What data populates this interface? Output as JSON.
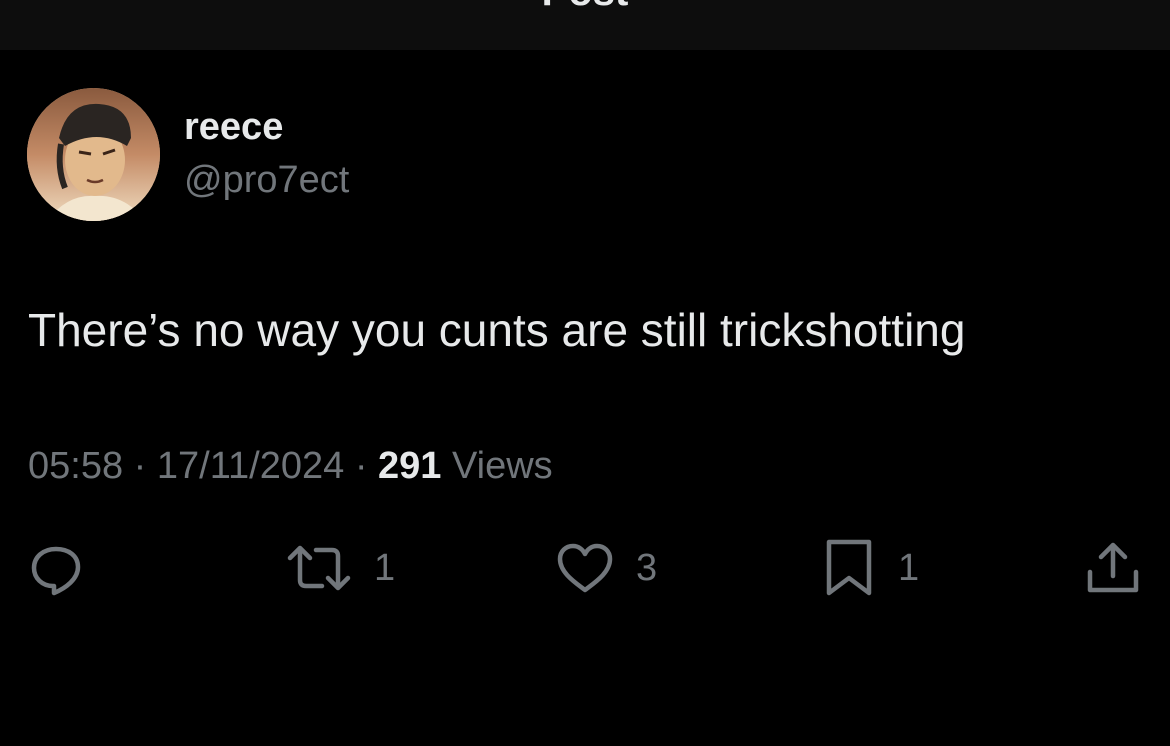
{
  "header": {
    "title": "Post"
  },
  "author": {
    "display_name": "reece",
    "handle": "@pro7ect"
  },
  "post": {
    "text": "There’s no way you cunts are still trickshotting",
    "time": "05:58",
    "date": "17/11/2024",
    "separator": "·",
    "views_count": "291",
    "views_label": "Views"
  },
  "actions": {
    "reply": {
      "icon": "reply-icon"
    },
    "repost": {
      "icon": "repost-icon",
      "count": "1"
    },
    "like": {
      "icon": "heart-icon",
      "count": "3"
    },
    "bookmark": {
      "icon": "bookmark-icon",
      "count": "1"
    },
    "share": {
      "icon": "share-icon"
    }
  },
  "colors": {
    "background": "#000000",
    "primary_text": "#e7e9ea",
    "secondary_text": "#71767b"
  }
}
